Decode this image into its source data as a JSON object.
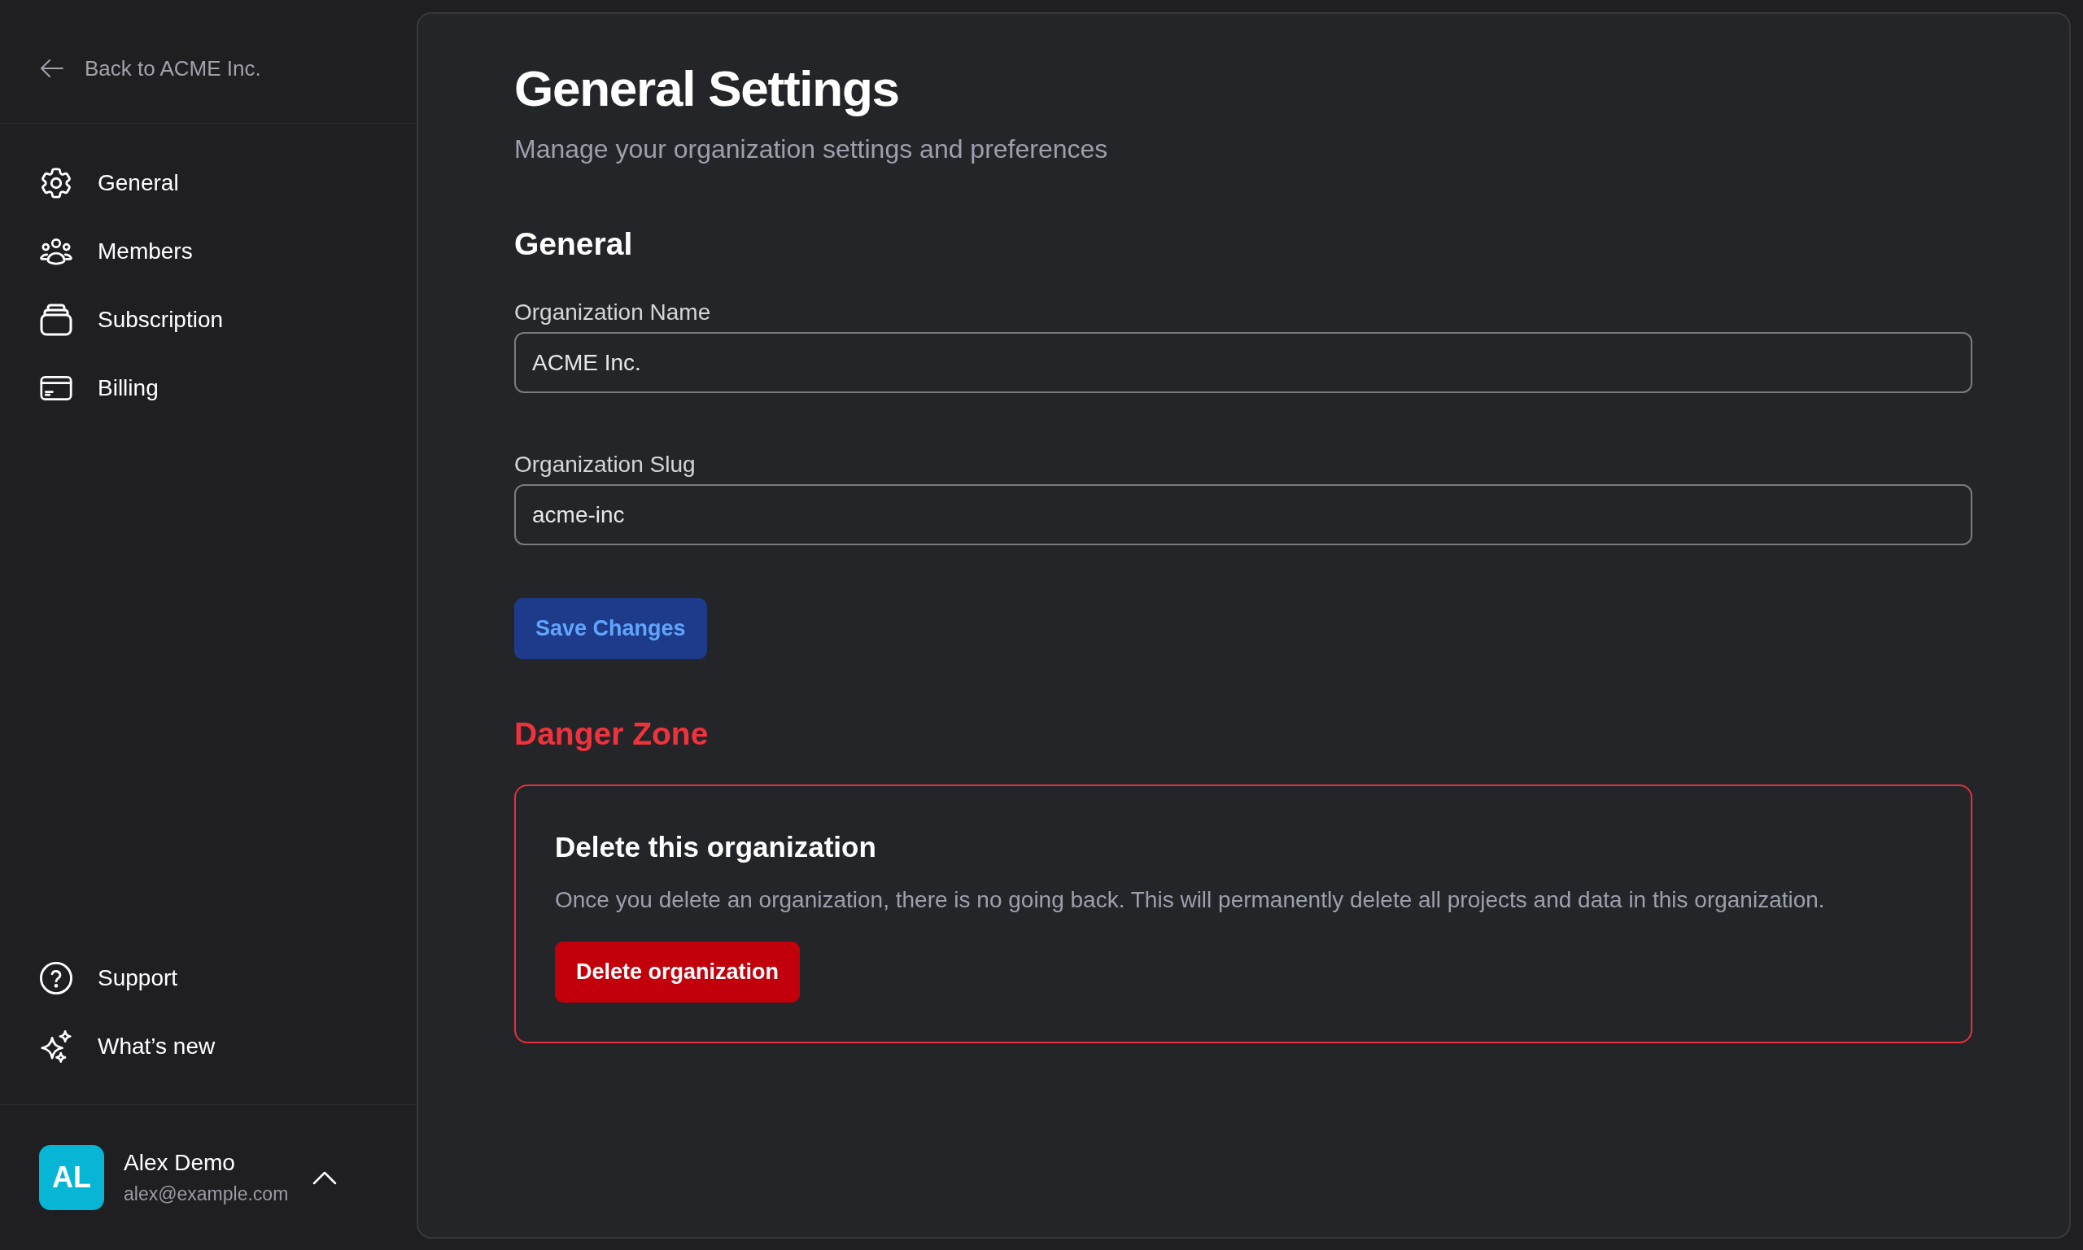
{
  "sidebar": {
    "back_link": "Back to ACME Inc.",
    "nav_items": [
      {
        "label": "General"
      },
      {
        "label": "Members"
      },
      {
        "label": "Subscription"
      },
      {
        "label": "Billing"
      }
    ],
    "footer_items": [
      {
        "label": "Support"
      },
      {
        "label": "What’s new"
      }
    ],
    "user": {
      "initials": "AL",
      "name": "Alex Demo",
      "email": "alex@example.com"
    }
  },
  "main": {
    "title": "General Settings",
    "subtitle": "Manage your organization settings and preferences",
    "general_section": {
      "heading": "General",
      "fields": [
        {
          "label": "Organization Name",
          "value": "ACME Inc."
        },
        {
          "label": "Organization Slug",
          "value": "acme-inc"
        }
      ],
      "save_button": "Save Changes"
    },
    "danger_zone": {
      "heading": "Danger Zone",
      "card_title": "Delete this organization",
      "description": "Once you delete an organization, there is no going back. This will permanently delete all projects and data in this organization.",
      "button": "Delete organization"
    }
  }
}
